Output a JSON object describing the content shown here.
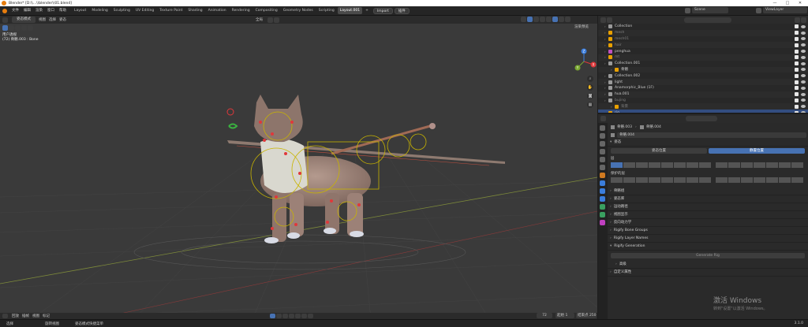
{
  "title_bar": {
    "title": "Blender* [D:\\\\...\\\\blender\\\\01.blend]",
    "controls": [
      "—",
      "□",
      "✕"
    ]
  },
  "menu": {
    "items": [
      "文件",
      "编辑",
      "渲染",
      "窗口",
      "帮助"
    ],
    "workspaces": [
      "Layout",
      "Modeling",
      "Sculpting",
      "UV Editing",
      "Texture Paint",
      "Shading",
      "Animation",
      "Rendering",
      "Compositing",
      "Geometry Nodes",
      "Scripting",
      "Layout.001"
    ],
    "active_workspace": "Layout.001",
    "add_tab": "+",
    "import_label": "Import",
    "extra_label": "插件",
    "scene_label": "Scene",
    "view_layer_label": "ViewLayer"
  },
  "viewport": {
    "mode": "姿态模式",
    "menus": [
      "视图",
      "选择",
      "姿态"
    ],
    "pivot": "全局",
    "info_line1": "用户透视",
    "info_line2": "(72) 骨骼.003 : Bone",
    "gizmo_axes": [
      "X",
      "Y",
      "Z"
    ],
    "shading_label": "渲染预览"
  },
  "outliner": {
    "items": [
      {
        "name": "Collection",
        "indent": 0,
        "dim": false,
        "selected": false,
        "color": "#9a9a9a"
      },
      {
        "name": "mesh",
        "indent": 0,
        "dim": true,
        "selected": false,
        "color": "#e8a000"
      },
      {
        "name": "mesh01",
        "indent": 0,
        "dim": true,
        "selected": false,
        "color": "#e8a000"
      },
      {
        "name": "hair",
        "indent": 0,
        "dim": true,
        "selected": false,
        "color": "#e8a000"
      },
      {
        "name": "penghua",
        "indent": 0,
        "dim": false,
        "selected": false,
        "color": "#c050c0"
      },
      {
        "name": "mt",
        "indent": 0,
        "dim": true,
        "selected": false,
        "color": "#e8a000"
      },
      {
        "name": "Collection.001",
        "indent": 0,
        "dim": false,
        "selected": false,
        "color": "#9a9a9a"
      },
      {
        "name": "骨骼",
        "indent": 1,
        "dim": false,
        "selected": false,
        "color": "#e8a000"
      },
      {
        "name": "Collection.002",
        "indent": 0,
        "dim": false,
        "selected": false,
        "color": "#9a9a9a"
      },
      {
        "name": "light",
        "indent": 0,
        "dim": false,
        "selected": false,
        "color": "#9a9a9a"
      },
      {
        "name": "Anamorphic_Blue (1F)",
        "indent": 0,
        "dim": false,
        "selected": false,
        "color": "#9a9a9a"
      },
      {
        "name": "hua.001",
        "indent": 0,
        "dim": false,
        "selected": false,
        "color": "#9a9a9a"
      },
      {
        "name": "bujing",
        "indent": 0,
        "dim": true,
        "selected": false,
        "color": "#9a9a9a"
      },
      {
        "name": "背景",
        "indent": 1,
        "dim": true,
        "selected": false,
        "color": "#e8a000"
      },
      {
        "name": "rig",
        "indent": 0,
        "dim": false,
        "selected": true,
        "color": "#e8a000"
      }
    ]
  },
  "properties": {
    "path": [
      "骨骼.003",
      "骨骼.004"
    ],
    "bone_name": "骨骼.004",
    "sections": {
      "pose": "姿态",
      "pose_position": "姿态位置",
      "rest_position": "静置位置",
      "layers": "层",
      "protected_layers": "保护的层",
      "bone_groups": "骨骼组",
      "pose_library": "姿态库",
      "motion_paths": "运动路径",
      "viewport_display": "视图显示",
      "inverse_kinematics": "反向动力学",
      "rigify_bone_groups": "Rigify Bone Groups",
      "rigify_layer_names": "Rigify Layer Names",
      "rigify_generation": "Rigify Generation",
      "generate_rig": "Generate Rig",
      "advanced": "高级",
      "custom_props": "自定义属性"
    }
  },
  "timeline": {
    "play_label": "回放",
    "keying_label": "插帧",
    "view_label": "视图",
    "marker_label": "标记",
    "current_frame": "72",
    "start_label": "起始",
    "start": "1",
    "end_label": "结束点",
    "end": "250"
  },
  "status": {
    "left": "选择",
    "middle": "旋转视图",
    "context": "姿态模式快捷菜单",
    "version": "3.1.0"
  },
  "watermark": {
    "line1": "激活 Windows",
    "line2": "转到\"设置\"以激活 Windows。"
  },
  "colors": {
    "accent": "#4772b3",
    "selected_row": "#334d80",
    "bone_yellow": "#c8b400",
    "bone_red": "#e0383b",
    "fur": "#a08579"
  }
}
